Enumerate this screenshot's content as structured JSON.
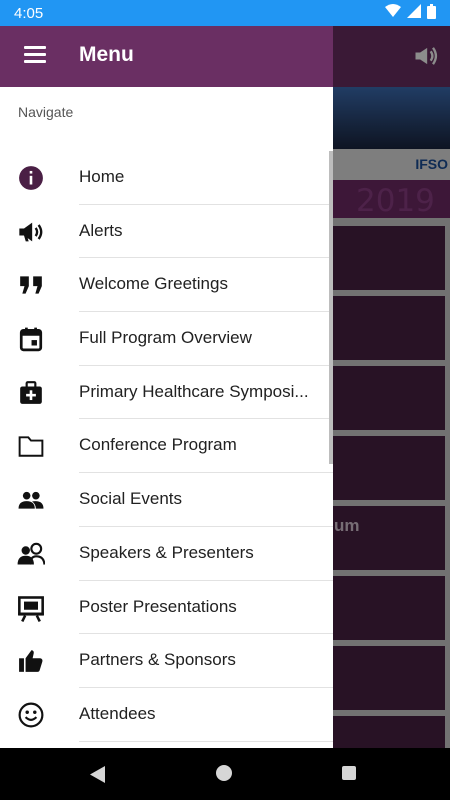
{
  "status_bar": {
    "time": "4:05"
  },
  "app_background": {
    "year": "2019",
    "logo_text": "IFSO",
    "tile_text": "um"
  },
  "drawer": {
    "title": "Menu",
    "caption": "Navigate",
    "items": [
      {
        "label": "Home",
        "icon": "info-icon"
      },
      {
        "label": "Alerts",
        "icon": "megaphone-icon"
      },
      {
        "label": "Welcome Greetings",
        "icon": "quote-icon"
      },
      {
        "label": "Full Program Overview",
        "icon": "calendar-icon"
      },
      {
        "label": "Primary Healthcare Symposi...",
        "icon": "medical-bag-icon"
      },
      {
        "label": "Conference Program",
        "icon": "folder-icon"
      },
      {
        "label": "Social Events",
        "icon": "people-icon"
      },
      {
        "label": "Speakers & Presenters",
        "icon": "speakers-icon"
      },
      {
        "label": "Poster Presentations",
        "icon": "easel-icon"
      },
      {
        "label": "Partners & Sponsors",
        "icon": "thumbs-up-icon"
      },
      {
        "label": "Attendees",
        "icon": "smiley-icon"
      }
    ]
  },
  "colors": {
    "status_bar": "#2196f3",
    "header": "#6a2f63",
    "icon_purple": "#4a1f45"
  }
}
